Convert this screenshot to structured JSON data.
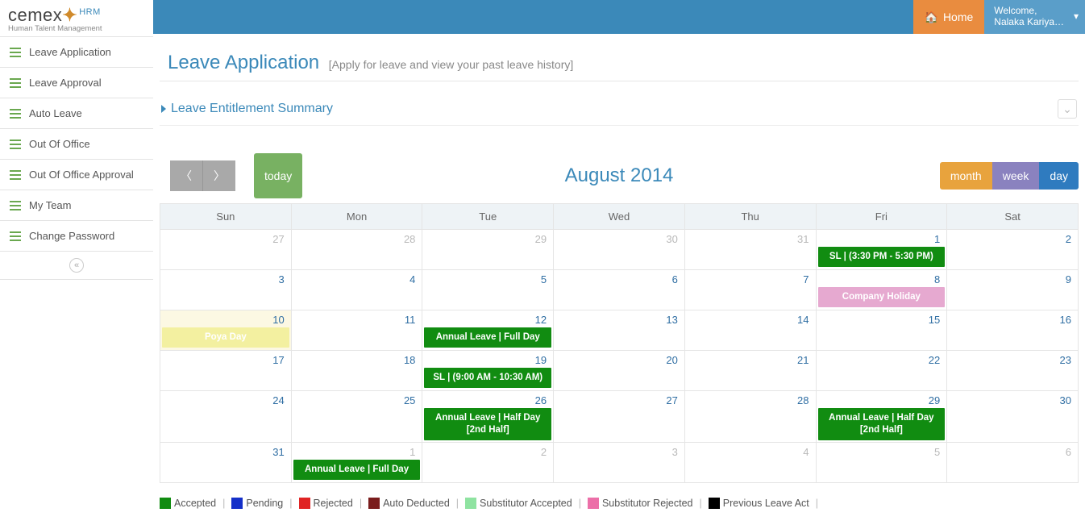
{
  "brand": {
    "name": "cemex",
    "suffix": "HRM",
    "tagline": "Human Talent Management"
  },
  "topbar": {
    "home": "Home",
    "welcome_label": "Welcome,",
    "user_name": "Nalaka Kariya…"
  },
  "sidebar": {
    "items": [
      {
        "label": "Leave Application"
      },
      {
        "label": "Leave Approval"
      },
      {
        "label": "Auto Leave"
      },
      {
        "label": "Out Of Office"
      },
      {
        "label": "Out Of Office Approval"
      },
      {
        "label": "My Team"
      },
      {
        "label": "Change Password"
      }
    ]
  },
  "page": {
    "title": "Leave Application",
    "subtitle": "[Apply for leave and view your past leave history]",
    "entitlement": "Leave Entitlement Summary"
  },
  "calendar": {
    "title": "August 2014",
    "today_label": "today",
    "views": {
      "month": "month",
      "week": "week",
      "day": "day"
    },
    "dow": [
      "Sun",
      "Mon",
      "Tue",
      "Wed",
      "Thu",
      "Fri",
      "Sat"
    ],
    "weeks": [
      [
        {
          "n": "27",
          "out": true
        },
        {
          "n": "28",
          "out": true
        },
        {
          "n": "29",
          "out": true
        },
        {
          "n": "30",
          "out": true
        },
        {
          "n": "31",
          "out": true
        },
        {
          "n": "1",
          "events": [
            {
              "text": "SL | (3:30 PM - 5:30 PM)",
              "type": "accepted"
            }
          ]
        },
        {
          "n": "2"
        }
      ],
      [
        {
          "n": "3"
        },
        {
          "n": "4"
        },
        {
          "n": "5"
        },
        {
          "n": "6"
        },
        {
          "n": "7"
        },
        {
          "n": "8",
          "events": [
            {
              "text": "Company Holiday",
              "type": "holiday"
            }
          ]
        },
        {
          "n": "9"
        }
      ],
      [
        {
          "n": "10",
          "today": true,
          "events": [
            {
              "text": "Poya Day",
              "type": "poya"
            }
          ]
        },
        {
          "n": "11"
        },
        {
          "n": "12",
          "events": [
            {
              "text": "Annual Leave | Full Day",
              "type": "accepted"
            }
          ]
        },
        {
          "n": "13"
        },
        {
          "n": "14"
        },
        {
          "n": "15"
        },
        {
          "n": "16"
        }
      ],
      [
        {
          "n": "17"
        },
        {
          "n": "18"
        },
        {
          "n": "19",
          "events": [
            {
              "text": "SL | (9:00 AM - 10:30 AM)",
              "type": "accepted"
            }
          ]
        },
        {
          "n": "20"
        },
        {
          "n": "21"
        },
        {
          "n": "22"
        },
        {
          "n": "23"
        }
      ],
      [
        {
          "n": "24"
        },
        {
          "n": "25"
        },
        {
          "n": "26",
          "events": [
            {
              "text": "Annual Leave | Half Day [2nd Half]",
              "type": "accepted"
            }
          ]
        },
        {
          "n": "27"
        },
        {
          "n": "28"
        },
        {
          "n": "29",
          "events": [
            {
              "text": "Annual Leave | Half Day [2nd Half]",
              "type": "accepted"
            }
          ]
        },
        {
          "n": "30"
        }
      ],
      [
        {
          "n": "31"
        },
        {
          "n": "1",
          "out": true,
          "events": [
            {
              "text": "Annual Leave | Full Day",
              "type": "accepted"
            }
          ]
        },
        {
          "n": "2",
          "out": true
        },
        {
          "n": "3",
          "out": true
        },
        {
          "n": "4",
          "out": true
        },
        {
          "n": "5",
          "out": true
        },
        {
          "n": "6",
          "out": true
        }
      ]
    ]
  },
  "legend": [
    {
      "label": "Accepted",
      "color": "#118c11"
    },
    {
      "label": "Pending",
      "color": "#1530c9"
    },
    {
      "label": "Rejected",
      "color": "#e02424"
    },
    {
      "label": "Auto Deducted",
      "color": "#7a1d1d"
    },
    {
      "label": "Substitutor Accepted",
      "color": "#8fe3a1"
    },
    {
      "label": "Substitutor Rejected",
      "color": "#ec6fa8"
    },
    {
      "label": "Previous Leave Act",
      "color": "#000000"
    }
  ]
}
